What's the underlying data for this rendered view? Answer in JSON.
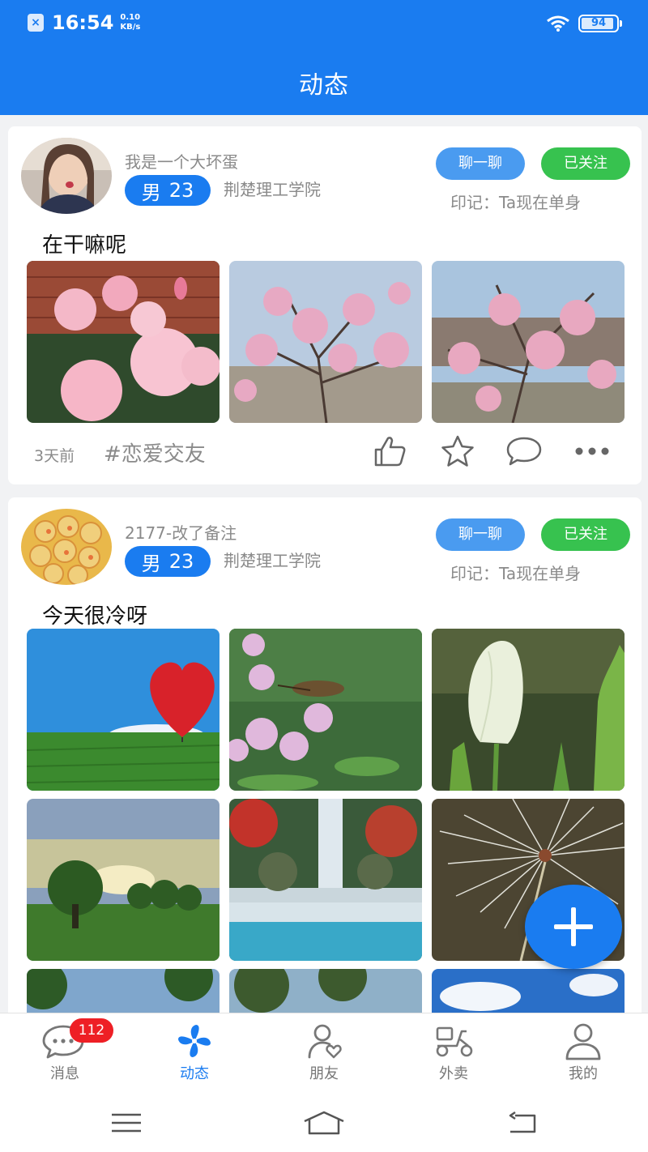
{
  "status_bar": {
    "time": "16:54",
    "net_speed_value": "0.10",
    "net_speed_unit": "KB/s",
    "battery": "94",
    "battery_level": 0.94
  },
  "header": {
    "title": "动态"
  },
  "posts": [
    {
      "nickname": "我是一个大坏蛋",
      "gender": "男",
      "age": "23",
      "school": "荆楚理工学院",
      "chat_label": "聊一聊",
      "follow_label": "已关注",
      "mark": "印记：Ta现在单身",
      "text": "在干嘛呢",
      "time": "3天前",
      "tag": "#恋爱交友"
    },
    {
      "nickname": "2177-改了备注",
      "gender": "男",
      "age": "23",
      "school": "荆楚理工学院",
      "chat_label": "聊一聊",
      "follow_label": "已关注",
      "mark": "印记：Ta现在单身",
      "text": "今天很冷呀"
    }
  ],
  "tabbar": {
    "tabs": [
      {
        "label": "消息",
        "badge": "112",
        "icon": "chat-bubble-icon"
      },
      {
        "label": "动态",
        "icon": "pinwheel-icon",
        "active": true
      },
      {
        "label": "朋友",
        "icon": "friend-heart-icon"
      },
      {
        "label": "外卖",
        "icon": "scooter-icon"
      },
      {
        "label": "我的",
        "icon": "person-icon"
      }
    ]
  },
  "colors": {
    "primary": "#1a7cf0",
    "follow_green": "#37c24f",
    "badge_red": "#ee1f25"
  }
}
